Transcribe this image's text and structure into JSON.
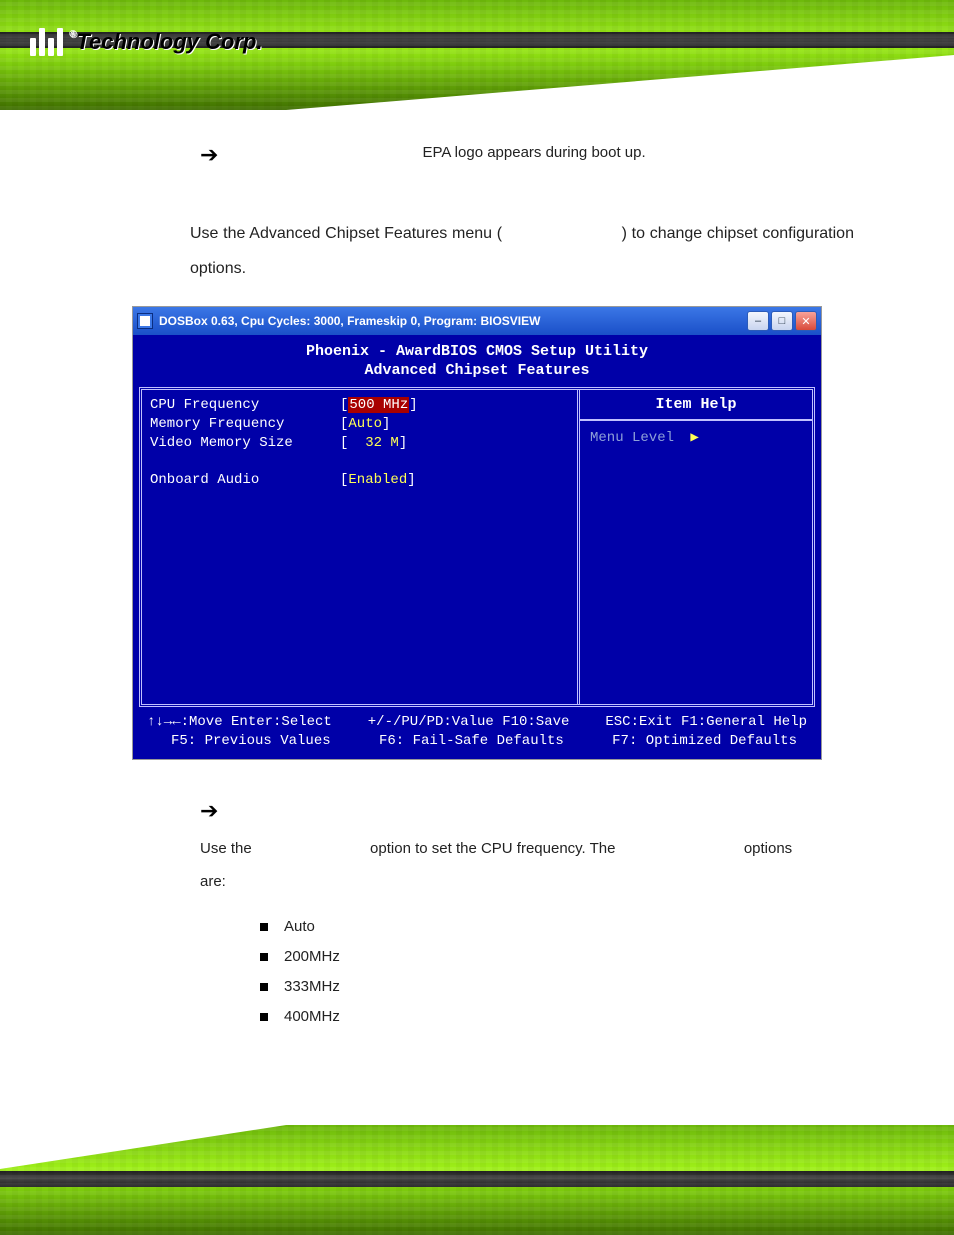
{
  "logo": {
    "brand": "Technology Corp."
  },
  "line1": {
    "text": "EPA logo appears during boot up."
  },
  "para1": {
    "pre": "Use  the  Advanced  Chipset  Features  menu  (",
    "post": ")  to  change  chipset configuration options."
  },
  "bios": {
    "titlebar": "DOSBox 0.63, Cpu Cycles:    3000, Frameskip  0, Program: BIOSVIEW",
    "header1": "Phoenix - AwardBIOS CMOS Setup Utility",
    "header2": "Advanced Chipset Features",
    "options": [
      {
        "label": "CPU Frequency",
        "value": "500 MHz",
        "style": "hl"
      },
      {
        "label": "Memory Frequency",
        "value": "Auto",
        "style": "yellow"
      },
      {
        "label": "Video Memory Size",
        "value": "  32 M",
        "style": "yellow"
      },
      {
        "label": "",
        "value": "",
        "style": "blank"
      },
      {
        "label": "Onboard Audio",
        "value": "Enabled",
        "style": "yellow"
      }
    ],
    "help_title": "Item Help",
    "menu_level": "Menu Level",
    "footer_l1_a": "↑↓→←:Move  Enter:Select",
    "footer_l1_b": "+/-/PU/PD:Value  F10:Save",
    "footer_l1_c": "ESC:Exit  F1:General Help",
    "footer_l2_a": "F5: Previous Values",
    "footer_l2_b": "F6: Fail-Safe Defaults",
    "footer_l2_c": "F7: Optimized Defaults"
  },
  "para2": {
    "a": "Use the",
    "b": "option to set the CPU frequency. The",
    "c": "options",
    "d": "are:"
  },
  "bullets": [
    "Auto",
    "200MHz",
    "333MHz",
    "400MHz"
  ]
}
